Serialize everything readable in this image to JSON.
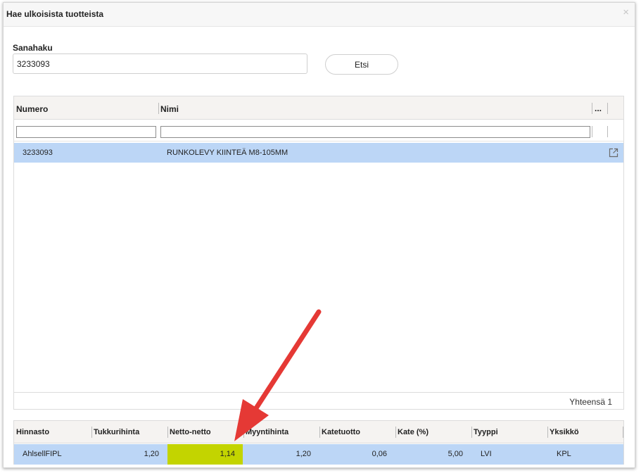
{
  "dialog": {
    "title": "Hae ulkoisista tuotteista",
    "close_glyph": "×"
  },
  "search": {
    "label": "Sanahaku",
    "value": "3233093",
    "button_label": "Etsi"
  },
  "products_table": {
    "columns": [
      "Numero",
      "Nimi",
      "..."
    ],
    "rows": [
      {
        "numero": "3233093",
        "nimi": "RUNKOLEVY KIINTEÄ M8-105MM",
        "action_icon": "external-link-icon"
      }
    ],
    "total_label": "Yhteensä 1"
  },
  "price_table": {
    "columns": [
      "Hinnasto",
      "Tukkurihinta",
      "Netto-netto",
      "Myyntihinta",
      "Katetuotto",
      "Kate (%)",
      "Tyyppi",
      "Yksikkö"
    ],
    "rows": [
      {
        "hinnasto": "AhlsellFIPL",
        "tukkurihinta": "1,20",
        "netto_netto": "1,14",
        "myyntihinta": "1,20",
        "katetuotto": "0,06",
        "kate": "5,00",
        "tyyppi": "LVI",
        "yksikko": "KPL"
      }
    ]
  },
  "colors": {
    "selected_row": "#bcd6f6",
    "highlight": "#c3d400",
    "arrow": "#e53935"
  }
}
